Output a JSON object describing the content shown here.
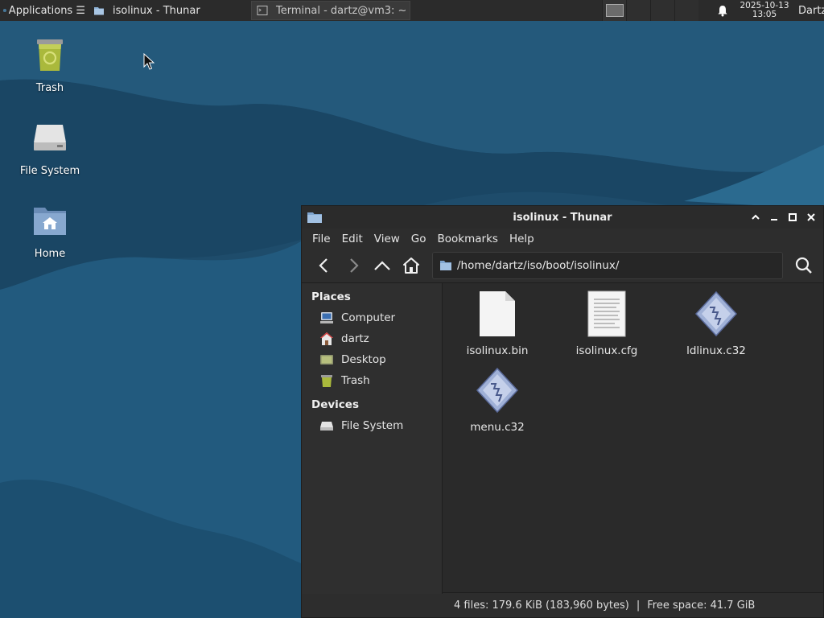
{
  "panel": {
    "applications_label": "Applications ☰",
    "tasks": [
      {
        "label": "isolinux - Thunar",
        "icon": "folder-icon",
        "active": true
      },
      {
        "label": "Terminal - dartz@vm3: ~",
        "icon": "terminal-icon",
        "active": false
      }
    ],
    "clock_date": "2025-10-13",
    "clock_time": "13:05",
    "user": "Dartz"
  },
  "desktop": {
    "icons": [
      {
        "label": "Trash",
        "icon": "trash-icon"
      },
      {
        "label": "File System",
        "icon": "drive-icon"
      },
      {
        "label": "Home",
        "icon": "home-folder-icon"
      }
    ]
  },
  "window": {
    "title": "isolinux - Thunar",
    "menu": [
      "File",
      "Edit",
      "View",
      "Go",
      "Bookmarks",
      "Help"
    ],
    "location": "/home/dartz/iso/boot/isolinux/",
    "sidebar": {
      "places_heading": "Places",
      "places": [
        {
          "label": "Computer",
          "icon": "computer-icon"
        },
        {
          "label": "dartz",
          "icon": "home-icon"
        },
        {
          "label": "Desktop",
          "icon": "desktop-icon"
        },
        {
          "label": "Trash",
          "icon": "trash-icon"
        }
      ],
      "devices_heading": "Devices",
      "devices": [
        {
          "label": "File System",
          "icon": "drive-icon"
        }
      ]
    },
    "files": [
      {
        "name": "isolinux.bin",
        "icon": "binary-file-icon"
      },
      {
        "name": "isolinux.cfg",
        "icon": "text-file-icon"
      },
      {
        "name": "ldlinux.c32",
        "icon": "executable-icon"
      },
      {
        "name": "menu.c32",
        "icon": "executable-icon"
      }
    ],
    "status": {
      "files_summary": "4 files: 179.6 KiB (183,960 bytes)",
      "separator": "|",
      "free_space": "Free space: 41.7 GiB"
    }
  },
  "colors": {
    "panel_bg": "#2b2b2b",
    "window_bg": "#2d2d2d",
    "wallpaper_dark": "#173c57",
    "wallpaper_light": "#2a6385"
  }
}
